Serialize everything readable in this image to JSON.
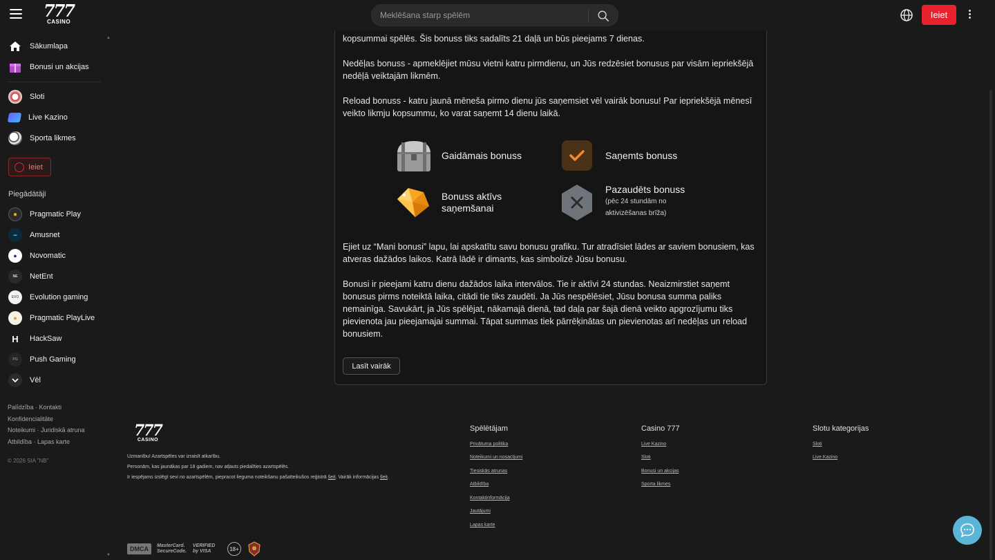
{
  "header": {
    "logo_number": "777",
    "logo_sub": "CASINO",
    "search_placeholder": "Meklēšana starp spēlēm",
    "login_label": "Ieiet"
  },
  "sidebar": {
    "main_items": [
      {
        "label": "Sākumlapa"
      },
      {
        "label": "Bonusi un akcijas"
      }
    ],
    "game_items": [
      {
        "label": "Sloti"
      },
      {
        "label": "Live Kazino"
      },
      {
        "label": "Sporta likmes"
      }
    ],
    "login_label": "Ieiet",
    "providers_title": "Piegādātāji",
    "providers": [
      {
        "label": "Pragmatic Play"
      },
      {
        "label": "Amusnet"
      },
      {
        "label": "Novomatic"
      },
      {
        "label": "NetEnt"
      },
      {
        "label": "Evolution gaming"
      },
      {
        "label": "Pragmatic PlayLive"
      },
      {
        "label": "HackSaw"
      },
      {
        "label": "Push Gaming"
      },
      {
        "label": "Vēl"
      }
    ],
    "footer_links": [
      "Palīdzība · Kontakti",
      "Konfidencialitāte",
      "Noteikumi · Juridiskā atruna",
      "Atbildība · Lapas karte"
    ],
    "copyright": "© 2026 SIA \"NB\""
  },
  "content": {
    "para1": "kopsummai spēlēs. Šis bonuss tiks sadalīts 21 daļā un būs pieejams 7 dienas.",
    "para2": "Nedēļas bonuss - apmeklējiet mūsu vietni katru pirmdienu, un Jūs redzēsiet bonusus par visām iepriekšējā nedēļā veiktajām likmēm.",
    "para3": "Reload bonuss - katru jaunā mēneša pirmo dienu jūs saņemsiet vēl vairāk bonusu! Par iepriekšējā mēnesī veikto likmju kopsummu, ko varat saņemt 14 dienu laikā.",
    "legend": {
      "pending": "Gaidāmais bonuss",
      "received": "Saņemts bonuss",
      "active_line1": "Bonuss aktīvs",
      "active_line2": "saņemšanai",
      "lost": "Pazaudēts bonuss",
      "lost_sub1": "(pēc 24 stundām no",
      "lost_sub2": "aktivizēšanas brīža)"
    },
    "para4": "Ejiet uz “Mani bonusi” lapu, lai apskatītu savu bonusu grafiku. Tur atradīsiet lādes ar saviem bonusiem, kas atveras dažādos laikos. Katrā lādē ir dimants, kas simbolizē Jūsu bonusu.",
    "para5": "Bonusi ir pieejami katru dienu dažādos laika intervālos. Tie ir aktīvi 24 stundas. Neaizmirstiet saņemt bonusus pirms noteiktā laika, citādi tie tiks zaudēti. Ja Jūs nespēlēsiet, Jūsu bonusa summa paliks nemainīga. Savukārt, ja Jūs spēlējat, nākamajā dienā, tad daļa par šajā dienā veikto apgrozījumu tiks pievienota jau pieejamajai summai. Tāpat summas tiek pārrēķinātas un pievienotas arī nedēļas un reload bonusiem.",
    "more_label": "Lasīt vairāk"
  },
  "footer": {
    "logo_number": "777",
    "logo_sub": "CASINO",
    "note1": "Uzmanību! Azartspēles var izraisīt atkarību.",
    "note2": "Personām, kas jaunākas par 18 gadiem, nav atļauts piedalīties azartspēlēs.",
    "note3a": "Ir iespējams izslēgt sevi no azartspēlēm, piepraсot liegumа noteikšanu pašatteikušos reģistrā ",
    "note3_link1": "šeit",
    "note3b": ". Vairāk informācijas ",
    "note3_link2": "šeit",
    "note3c": ".",
    "col1_title": "Spēlētājam",
    "col1_links": [
      "Privātuma politika",
      "Noteikumi un nosacījumi",
      "Tiesiskās atrunas",
      "Atbildība",
      "Kontaktinformācija",
      "Jautājumi",
      "Lapas karte"
    ],
    "col2_title": "Casino 777",
    "col2_links": [
      "Live Kazino",
      "Sloti",
      "Bonusi un akcijas",
      "Sporta likmes"
    ],
    "col3_title": "Slotu kategorijas",
    "col3_links": [
      "Sloti",
      "Live Kazino"
    ],
    "badges": [
      "DMCA",
      "MasterCard. SecureCode.",
      "VERIFIED by VISA",
      "18+"
    ]
  },
  "colors": {
    "accent": "#e8232d",
    "chat": "#5bb5d6",
    "received_tile": "#4a3218",
    "check": "#f08a2a"
  }
}
